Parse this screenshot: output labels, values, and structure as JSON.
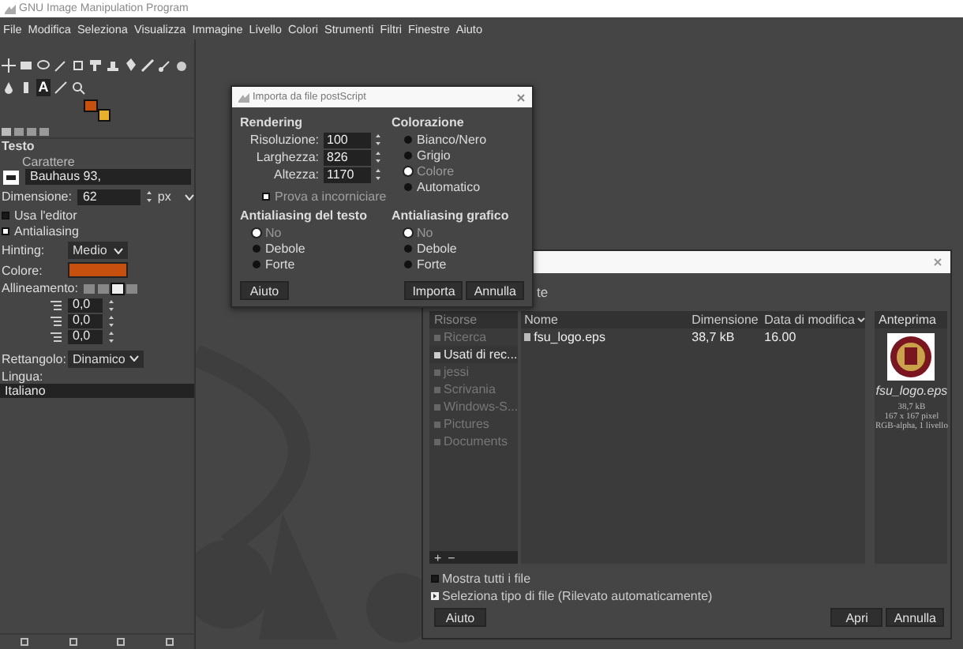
{
  "window": {
    "title": "GNU Image Manipulation Program"
  },
  "menu": [
    {
      "label": "File"
    },
    {
      "label": "Modifica"
    },
    {
      "label": "Seleziona"
    },
    {
      "label": "Visualizza"
    },
    {
      "label": "Immagine"
    },
    {
      "label": "Livello"
    },
    {
      "label": "Colori"
    },
    {
      "label": "Strumenti"
    },
    {
      "label": "Filtri"
    },
    {
      "label": "Finestre"
    },
    {
      "label": "Aiuto"
    }
  ],
  "toolbox": {
    "text_tool_glyph": "A"
  },
  "tool_options": {
    "title": "Testo",
    "font_label": "Carattere",
    "font": "Bauhaus 93,",
    "size_label": "Dimensione:",
    "size": "62",
    "unit": "px",
    "use_editor": {
      "label": "Usa l'editor",
      "checked": false
    },
    "antialiasing": {
      "label": "Antialiasing",
      "checked": true
    },
    "hinting_label": "Hinting:",
    "hinting": "Medio",
    "color_label": "Colore:",
    "justify_label": "Allineamento:",
    "justify": [
      {
        "selected": false
      },
      {
        "selected": false
      },
      {
        "selected": true
      },
      {
        "selected": false
      }
    ],
    "spacing": [
      "0,0",
      "0,0",
      "0,0"
    ],
    "box_label": "Rettangolo:",
    "box": "Dinamico",
    "language_label": "Lingua:",
    "language": "Italiano"
  },
  "import_dialog": {
    "title": "Importa da file postScript",
    "rendering": {
      "heading": "Rendering",
      "fields": [
        {
          "label": "Risoluzione:",
          "value": "100"
        },
        {
          "label": "Larghezza:",
          "value": "826"
        },
        {
          "label": "Altezza:",
          "value": "1170"
        }
      ]
    },
    "try_bbox": {
      "label": "Prova a incorniciare",
      "checked": true
    },
    "coloring": {
      "heading": "Colorazione",
      "options": [
        {
          "label": "Bianco/Nero",
          "selected": false
        },
        {
          "label": "Grigio",
          "selected": false
        },
        {
          "label": "Colore",
          "selected": true
        },
        {
          "label": "Automatico",
          "selected": false
        }
      ]
    },
    "text_antialiasing": {
      "heading": "Antialiasing del testo",
      "options": [
        {
          "label": "No",
          "selected": true
        },
        {
          "label": "Debole",
          "selected": false
        },
        {
          "label": "Forte",
          "selected": false
        }
      ]
    },
    "graphic_antialiasing": {
      "heading": "Antialiasing grafico",
      "options": [
        {
          "label": "No",
          "selected": true
        },
        {
          "label": "Debole",
          "selected": false
        },
        {
          "label": "Forte",
          "selected": false
        }
      ]
    },
    "buttons": {
      "help": "Aiuto",
      "ok": "Importa",
      "cancel": "Annulla"
    }
  },
  "file_dialog": {
    "title_fragment": "te",
    "places": {
      "heading": "Risorse",
      "items": [
        {
          "label": "Ricerca",
          "selected": false
        },
        {
          "label": "Usati di rec...",
          "selected": true
        },
        {
          "label": "jessi",
          "selected": false
        },
        {
          "label": "Scrivania",
          "selected": false
        },
        {
          "label": "Windows-S...",
          "selected": false
        },
        {
          "label": "Pictures",
          "selected": false
        },
        {
          "label": "Documents",
          "selected": false
        }
      ],
      "add": "+",
      "remove": "−"
    },
    "columns": [
      "Nome",
      "Dimensione",
      "Data di modifica"
    ],
    "rows": [
      {
        "name": "fsu_logo.eps",
        "size": "38,7 kB",
        "modified": "16.00"
      }
    ],
    "preview": {
      "heading": "Anteprima",
      "name": "fsu_logo.eps",
      "info": [
        "38,7 kB",
        "167 x 167 pixel",
        "RGB-alpha, 1 livello"
      ]
    },
    "show_all": {
      "label": "Mostra tutti i file",
      "checked": false
    },
    "file_type": {
      "label": "Seleziona tipo di file (Rilevato automaticamente)",
      "expanded": false
    },
    "buttons": {
      "help": "Aiuto",
      "open": "Apri",
      "cancel": "Annulla"
    }
  }
}
